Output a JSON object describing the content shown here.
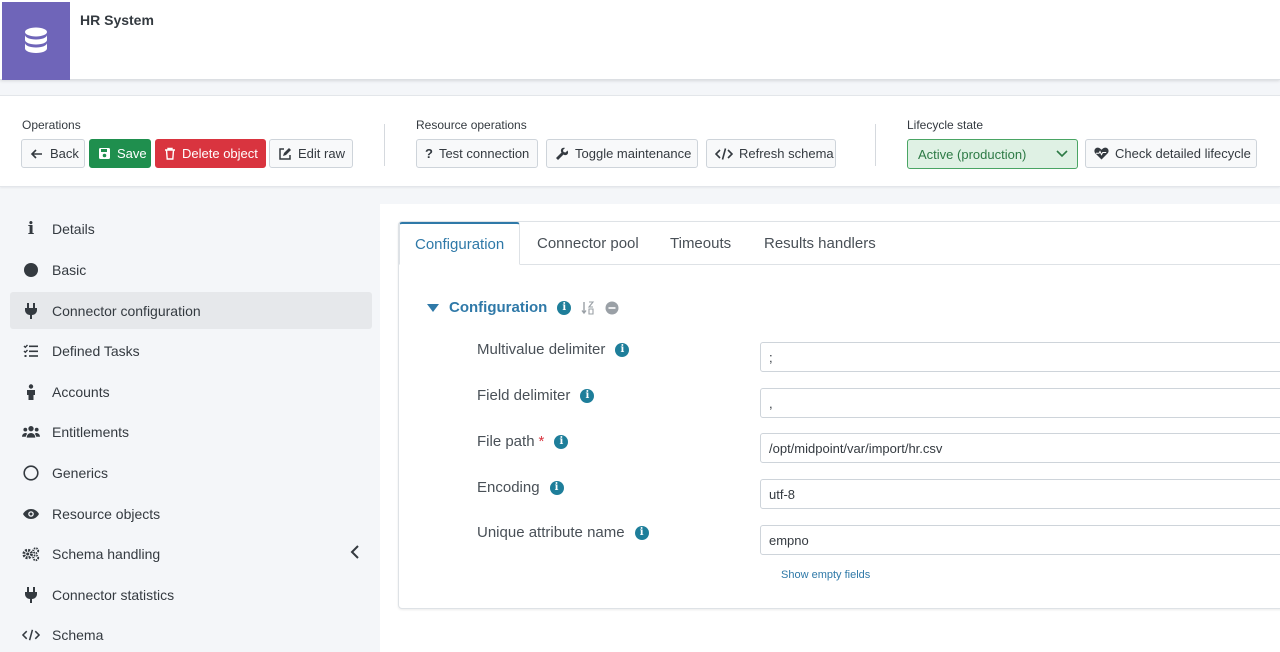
{
  "header": {
    "title": "HR System",
    "logo_icon": "database-icon",
    "logo_color": "#6f65b9"
  },
  "operations": {
    "label": "Operations",
    "back": "Back",
    "save": "Save",
    "delete": "Delete object",
    "edit_raw": "Edit raw"
  },
  "resource_operations": {
    "label": "Resource operations",
    "test_connection": "Test connection",
    "toggle_maintenance": "Toggle maintenance",
    "refresh_schema": "Refresh schema"
  },
  "lifecycle": {
    "label": "Lifecycle state",
    "selected": "Active (production)",
    "check_detailed": "Check detailed lifecycle"
  },
  "sidebar": {
    "items": [
      {
        "label": "Details",
        "icon": "info-icon"
      },
      {
        "label": "Basic",
        "icon": "circle-icon"
      },
      {
        "label": "Connector configuration",
        "icon": "plug-icon",
        "active": true
      },
      {
        "label": "Defined Tasks",
        "icon": "tasks-icon"
      },
      {
        "label": "Accounts",
        "icon": "person-icon"
      },
      {
        "label": "Entitlements",
        "icon": "users-icon"
      },
      {
        "label": "Generics",
        "icon": "circle-outline-icon"
      },
      {
        "label": "Resource objects",
        "icon": "eye-icon"
      },
      {
        "label": "Schema handling",
        "icon": "cogs-icon"
      },
      {
        "label": "Connector statistics",
        "icon": "plug-icon"
      },
      {
        "label": "Schema",
        "icon": "code-icon"
      }
    ]
  },
  "tabs": [
    "Configuration",
    "Connector pool",
    "Timeouts",
    "Results handlers"
  ],
  "configuration": {
    "title": "Configuration",
    "fields": [
      {
        "label": "Multivalue delimiter",
        "value": ";"
      },
      {
        "label": "Field delimiter",
        "value": ","
      },
      {
        "label": "File path",
        "value": "/opt/midpoint/var/import/hr.csv",
        "required": "*"
      },
      {
        "label": "Encoding",
        "value": "utf-8"
      },
      {
        "label": "Unique attribute name",
        "value": "empno"
      }
    ],
    "show_empty": "Show empty fields",
    "info_glyph": "i"
  },
  "colors": {
    "accent": "#2f79a8",
    "save": "#1f8f4e",
    "delete": "#d9343f",
    "lifecycle_bg": "#dff1e4"
  }
}
